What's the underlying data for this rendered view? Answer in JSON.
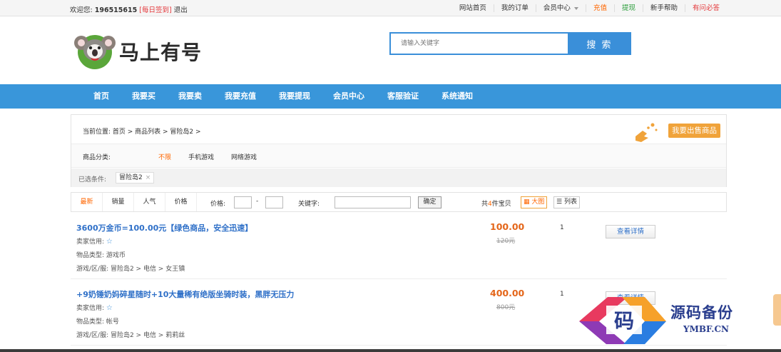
{
  "topbar": {
    "welcome": "欢迎您:",
    "user_id": "196515615",
    "checkin": "[每日签到]",
    "logout": "退出",
    "links": [
      {
        "label": "网站首页",
        "color": "default"
      },
      {
        "label": "我的订单",
        "color": "default"
      },
      {
        "label": "会员中心",
        "color": "default"
      },
      {
        "label": "充值",
        "color": "orange"
      },
      {
        "label": "提现",
        "color": "green"
      },
      {
        "label": "新手帮助",
        "color": "default"
      },
      {
        "label": "有问必答",
        "color": "red"
      }
    ]
  },
  "header": {
    "logo_text": "马上有号",
    "search_placeholder": "请输入关键字",
    "search_button": "搜 索"
  },
  "nav": [
    "首页",
    "我要买",
    "我要卖",
    "我要充值",
    "我要提现",
    "会员中心",
    "客服验证",
    "系统通知"
  ],
  "breadcrumb": "当前位置: 首页 > 商品列表 > 冒险岛2 >",
  "sell_button": "我要出售商品",
  "category": {
    "label": "商品分类:",
    "options": [
      "不限",
      "手机游戏",
      "网络游戏"
    ]
  },
  "selected": {
    "label": "已选条件:",
    "chip": "冒险岛2",
    "remove": "×"
  },
  "sortbar": {
    "tabs": [
      "最新",
      "销量",
      "人气",
      "价格"
    ],
    "price_label": "价格:",
    "dash": "-",
    "keyword_label": "关键字:",
    "confirm": "确定",
    "total_prefix": "共",
    "total_count": "4",
    "total_suffix": "件宝贝",
    "view_large": "大图",
    "view_list": "列表"
  },
  "products": [
    {
      "title": "3600万金币=100.00元【绿色商品，安全迅速】",
      "seller_label": "卖家信用:",
      "type": "物品类型:  游戏币",
      "region": "游戏/区/服:  冒险岛2 > 电信 > 女王镇",
      "price": "100.00",
      "old_price": "120元",
      "qty": "1",
      "button": "查看详情"
    },
    {
      "title": "+9奶锤奶妈碎星随时+10大量稀有绝版坐骑时装，黑胖无压力",
      "seller_label": "卖家信用:",
      "type": "物品类型:  帐号",
      "region": "游戏/区/服:  冒险岛2 > 电信 > 莉莉丝",
      "price": "400.00",
      "old_price": "800元",
      "qty": "1",
      "button": "查看详情"
    }
  ],
  "watermark": {
    "glyph": "码",
    "title": "源码备份",
    "site": "YMBF.CN"
  },
  "colors": {
    "nav_bg": "#3996da",
    "accent_orange": "#f60",
    "link_blue": "#2f70c8",
    "price": "#e4661a"
  }
}
